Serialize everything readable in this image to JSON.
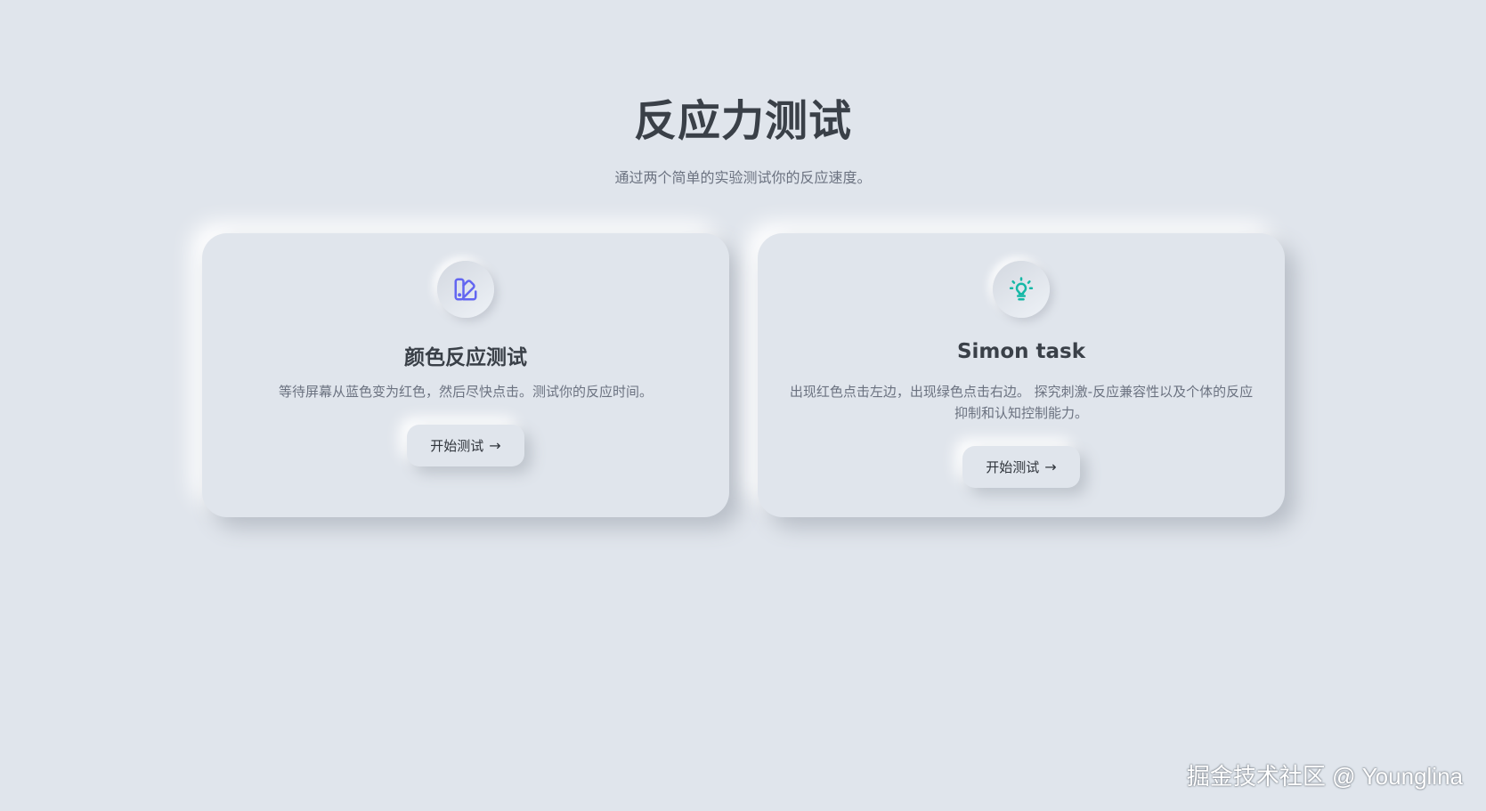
{
  "hero": {
    "title": "反应力测试",
    "subtitle": "通过两个简单的实验测试你的反应速度。"
  },
  "cards": [
    {
      "icon": "palette-icon",
      "icon_color": "#6366f1",
      "title": "颜色反应测试",
      "description": "等待屏幕从蓝色变为红色，然后尽快点击。测试你的反应时间。",
      "button_label": "开始测试",
      "button_arrow": "→"
    },
    {
      "icon": "lightbulb-icon",
      "icon_color": "#14b8a6",
      "title": "Simon task",
      "description": "出现红色点击左边，出现绿色点击右边。 探究刺激-反应兼容性以及个体的反应抑制和认知控制能力。",
      "button_label": "开始测试",
      "button_arrow": "→"
    }
  ],
  "watermark": "掘金技术社区 @ Younglina",
  "colors": {
    "background": "#e0e5ec",
    "text_primary": "#3a4048",
    "text_secondary": "#6b7280"
  }
}
